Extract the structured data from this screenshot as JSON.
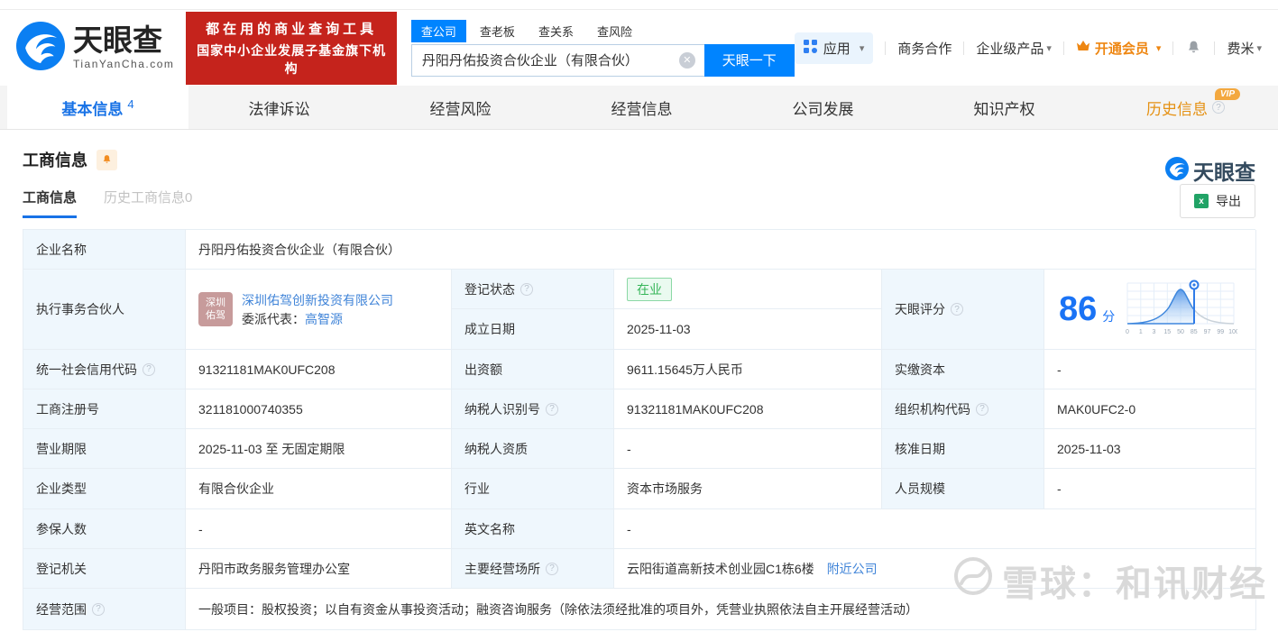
{
  "header": {
    "brand": "天眼查",
    "brand_domain": "TianYanCha.com",
    "slogan_line1": "都在用的商业查询工具",
    "slogan_line2": "国家中小企业发展子基金旗下机构",
    "search": {
      "tabs": [
        "查公司",
        "查老板",
        "查关系",
        "查风险"
      ],
      "input_value": "丹阳丹佑投资合伙企业（有限合伙）",
      "submit_label": "天眼一下"
    },
    "menu": {
      "apps": "应用",
      "business_cooperation": "商务合作",
      "enterprise_products": "企业级产品",
      "open_vip": "开通会员",
      "username": "费米"
    }
  },
  "nav": {
    "tabs": [
      "基本信息",
      "法律诉讼",
      "经营风险",
      "经营信息",
      "公司发展",
      "知识产权",
      "历史信息"
    ],
    "active_tab": "基本信息",
    "active_count": "4",
    "vip_badge": "VIP"
  },
  "section": {
    "title": "工商信息",
    "subtab_active": "工商信息",
    "subtab_history": "历史工商信息0",
    "export_label": "导出",
    "brand_watermark": "天眼查"
  },
  "table": {
    "company_name": {
      "label": "企业名称",
      "value": "丹阳丹佑投资合伙企业（有限合伙）"
    },
    "partner": {
      "label": "执行事务合伙人",
      "avatar_line1": "深圳",
      "avatar_line2": "佑驾",
      "company": "深圳佑驾创新投资有限公司",
      "delegate_prefix": "委派代表：",
      "delegate": "高智源"
    },
    "reg_status": {
      "label": "登记状态",
      "value": "在业"
    },
    "establish_date": {
      "label": "成立日期",
      "value": "2025-11-03"
    },
    "score": {
      "label": "天眼评分",
      "value": "86",
      "unit": "分",
      "axis_ticks": [
        "0",
        "1",
        "3",
        "15",
        "50",
        "85",
        "97",
        "99",
        "100"
      ],
      "marker_at": "85"
    },
    "credit_code": {
      "label": "统一社会信用代码",
      "value": "91321181MAK0UFC208"
    },
    "capital": {
      "label": "出资额",
      "value": "9611.15645万人民币"
    },
    "paid_capital": {
      "label": "实缴资本",
      "value": "-"
    },
    "reg_number": {
      "label": "工商注册号",
      "value": "321181000740355"
    },
    "taxpayer_id": {
      "label": "纳税人识别号",
      "value": "91321181MAK0UFC208"
    },
    "org_code": {
      "label": "组织机构代码",
      "value": "MAK0UFC2-0"
    },
    "business_term": {
      "label": "营业期限",
      "value": "2025-11-03 至 无固定期限"
    },
    "taxpayer_quality": {
      "label": "纳税人资质",
      "value": "-"
    },
    "approval_date": {
      "label": "核准日期",
      "value": "2025-11-03"
    },
    "company_type": {
      "label": "企业类型",
      "value": "有限合伙企业"
    },
    "industry": {
      "label": "行业",
      "value": "资本市场服务"
    },
    "staff_size": {
      "label": "人员规模",
      "value": "-"
    },
    "insured_count": {
      "label": "参保人数",
      "value": "-"
    },
    "english_name": {
      "label": "英文名称",
      "value": "-"
    },
    "reg_authority": {
      "label": "登记机关",
      "value": "丹阳市政务服务管理办公室"
    },
    "business_place": {
      "label": "主要经营场所",
      "value": "云阳街道高新技术创业园C1栋6楼",
      "nearby_link": "附近公司"
    },
    "business_scope": {
      "label": "经营范围",
      "value": "一般项目：股权投资；以自有资金从事投资活动；融资咨询服务（除依法须经批准的项目外，凭营业执照依法自主开展经营活动）"
    }
  },
  "page_watermark": "雪球：和讯财经",
  "colors": {
    "brand_blue": "#0084ff",
    "link_blue": "#4084d8",
    "active_tab_blue": "#1872e6",
    "banner_red": "#c5231c",
    "vip_orange": "#ee8611",
    "status_green": "#35b558",
    "label_cell_bg": "#eff7fd",
    "score_blue": "#1a73f5"
  }
}
